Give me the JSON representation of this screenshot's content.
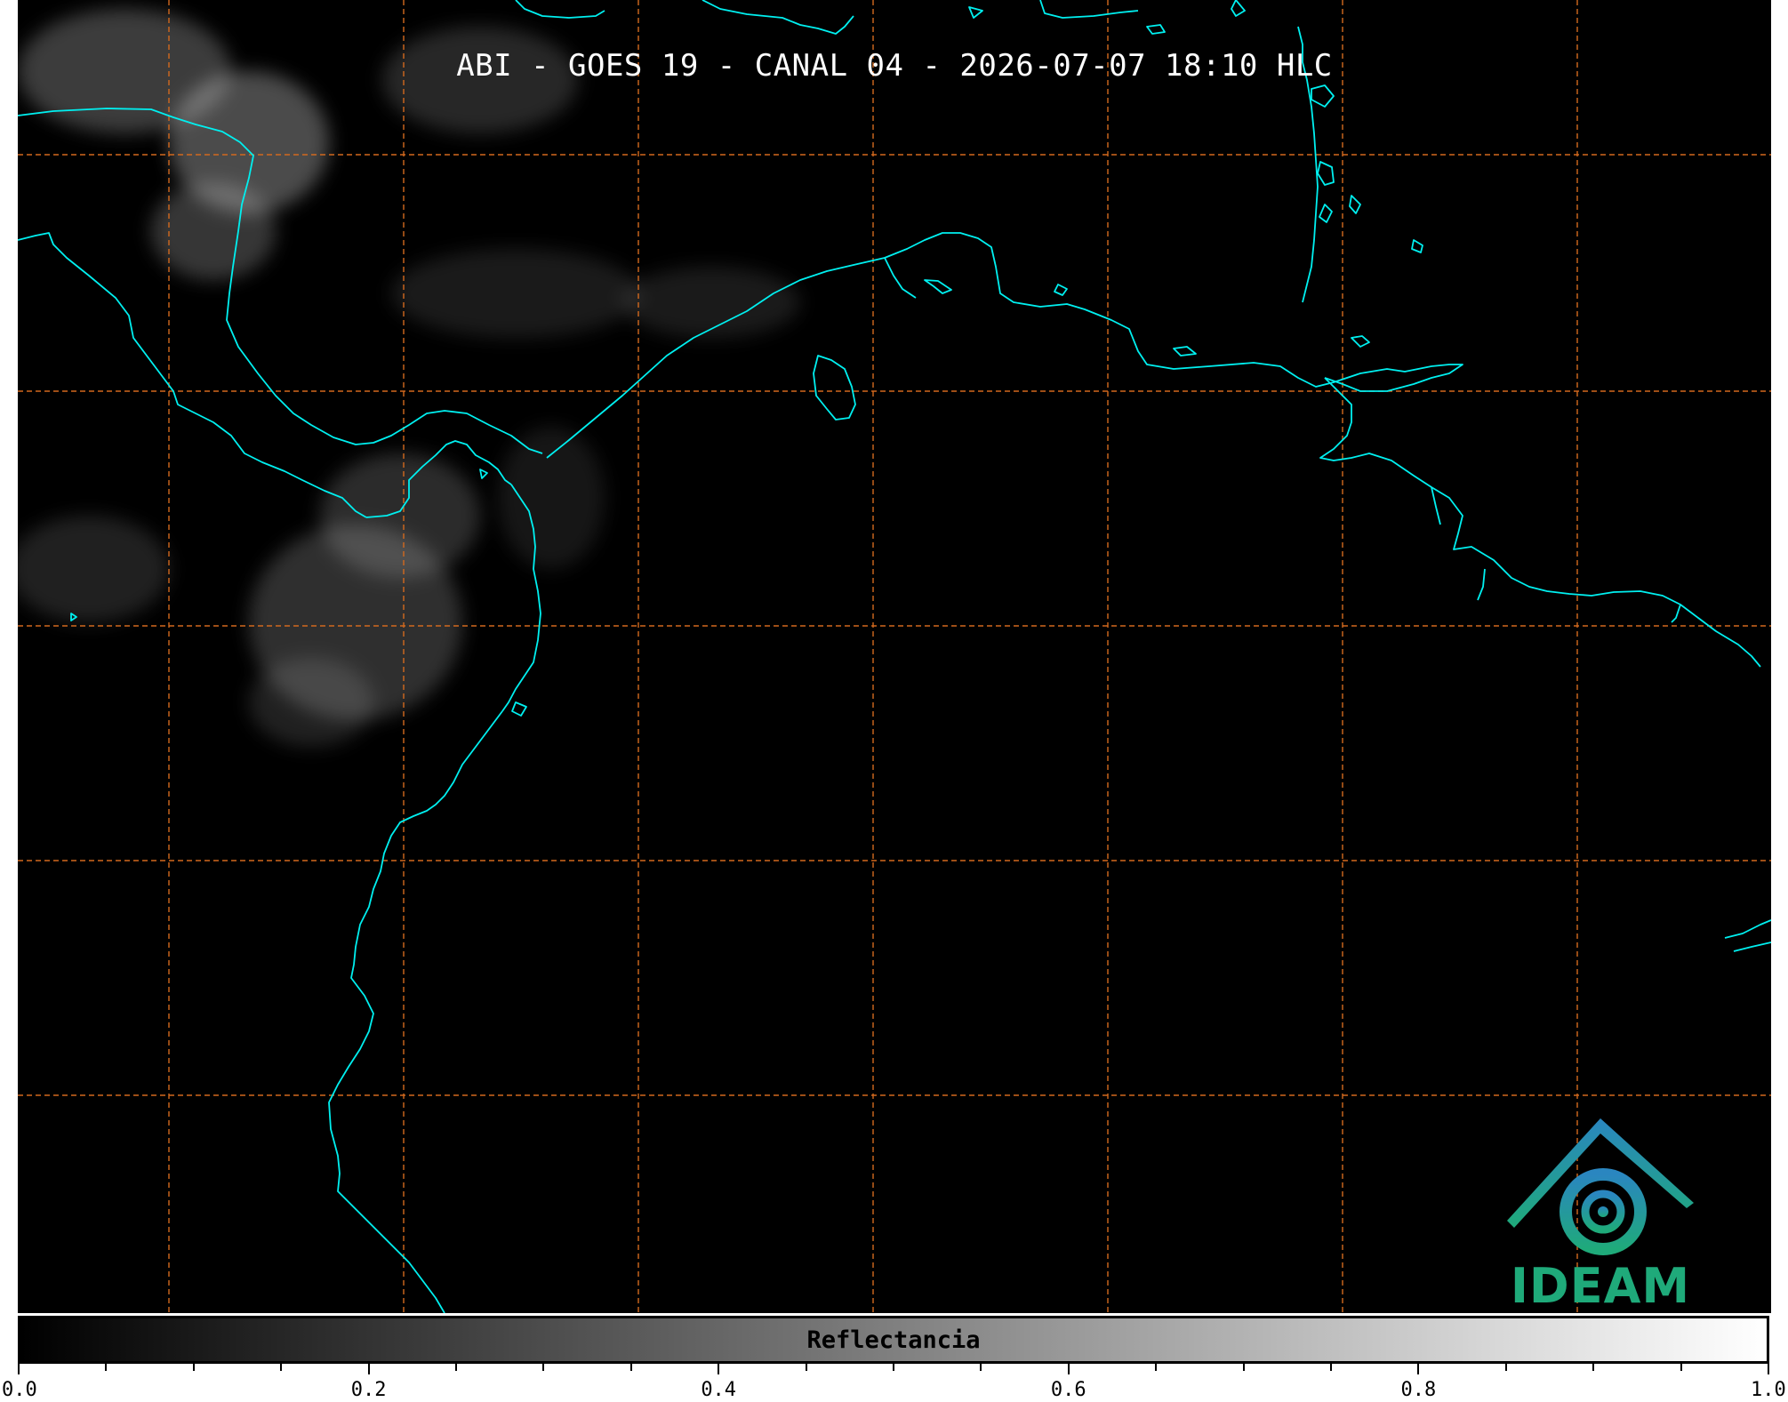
{
  "map": {
    "title": "ABI - GOES 19 - CANAL 04 - 2026-07-07 18:10 HLC",
    "coastline_color": "#00f0f0",
    "grid_color": "#d2691e",
    "background_color": "#000000"
  },
  "logo": {
    "text": "IDEAM",
    "colors": [
      "#2a86c0",
      "#1faa7a"
    ],
    "icon": "ideam-logo-icon"
  },
  "colorbar": {
    "label": "Reflectancia",
    "range": [
      0.0,
      1.0
    ],
    "gradient": [
      "#000000",
      "#ffffff"
    ],
    "tick_labels": [
      "0.0",
      "0.2",
      "0.4",
      "0.6",
      "0.8",
      "1.0"
    ],
    "major_ticks": [
      0.0,
      0.2,
      0.4,
      0.6,
      0.8,
      1.0
    ],
    "minor_step": 0.05
  }
}
